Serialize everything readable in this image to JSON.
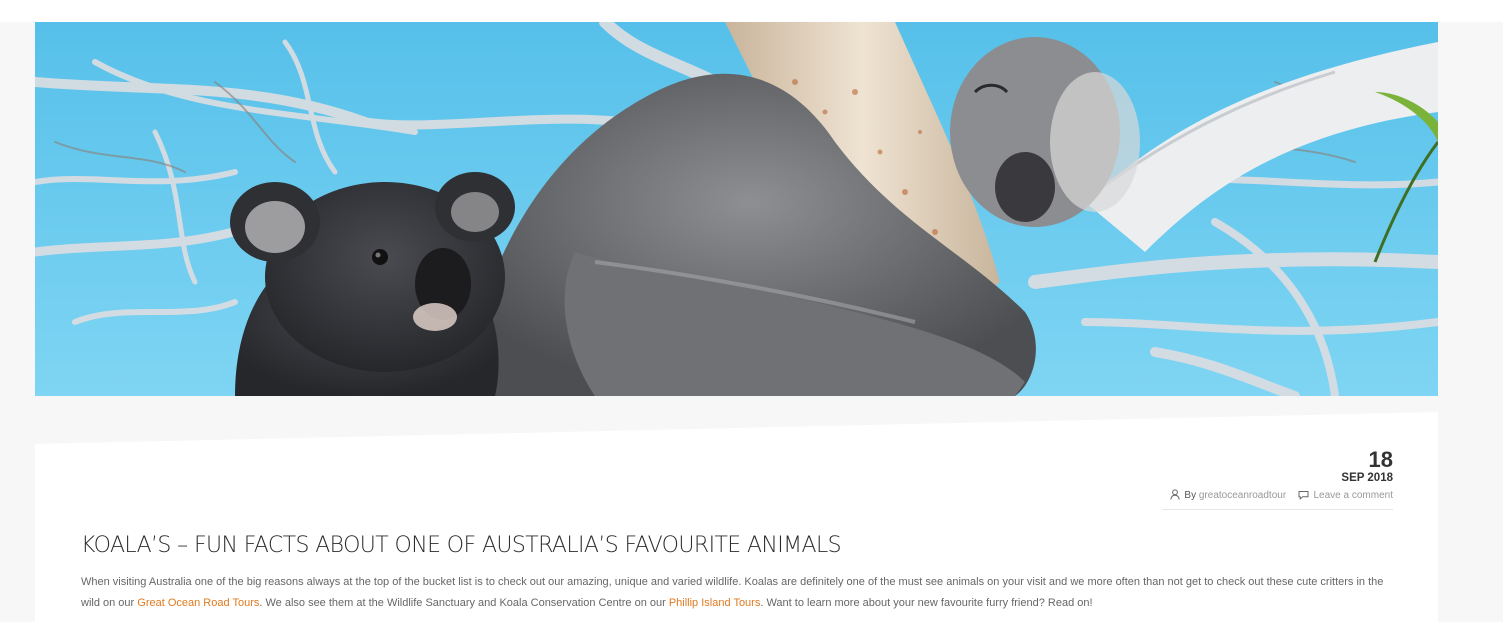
{
  "hero": {
    "image_subject": "koala-with-joey-in-gum-tree"
  },
  "post": {
    "date": {
      "day": "18",
      "month_year": "SEP 2018"
    },
    "meta": {
      "by_label": "By",
      "author": "greatoceanroadtour",
      "comments_link": "Leave a comment"
    },
    "title": "KOALA’S – FUN FACTS ABOUT ONE OF AUSTRALIA’S FAVOURITE ANIMALS",
    "body": {
      "part1": "When visiting Australia one of the big reasons always at the top of the bucket list is to check out our amazing, unique and varied wildlife. Koalas are definitely one of the must see animals on your visit and we more often than not get to check out these cute critters in the wild on our ",
      "link1": "Great Ocean Road Tours",
      "part2": ". We also see them at the Wildlife Sanctuary and Koala Conservation Centre on our ",
      "link2": "Phillip Island Tours",
      "part3": ". Want to learn more about your new favourite furry friend? Read on!"
    }
  },
  "colors": {
    "link": "#e07a1f",
    "title": "#2d2d2d",
    "body_text": "#666666",
    "page_background": "#f7f7f7",
    "sky": "#5fc6ec"
  }
}
